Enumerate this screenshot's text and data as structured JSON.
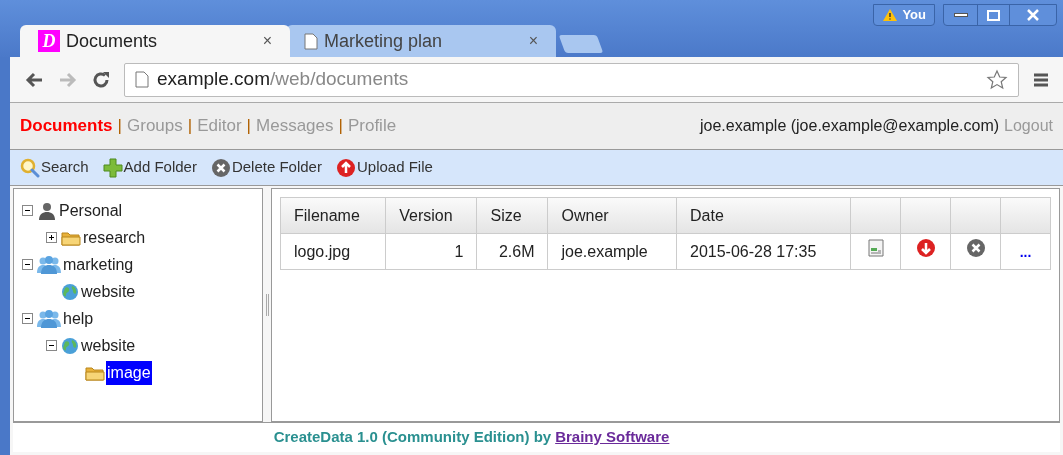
{
  "browser": {
    "tabs": [
      {
        "title": "Documents",
        "kind": "app",
        "favicon": "D",
        "selected": true,
        "close": "×"
      },
      {
        "title": "Marketing plan",
        "kind": "page",
        "selected": false,
        "close": "×"
      }
    ],
    "profile": "You",
    "url_host": "example.com",
    "url_path": "/web/documents"
  },
  "nav": {
    "separator": "|",
    "items": [
      {
        "label": "Documents",
        "selected": true
      },
      {
        "label": "Groups",
        "selected": false
      },
      {
        "label": "Editor",
        "selected": false
      },
      {
        "label": "Messages",
        "selected": false
      },
      {
        "label": "Profile",
        "selected": false
      }
    ],
    "user": "joe.example (joe.example@example.com)",
    "logout": "Logout"
  },
  "toolbar": [
    {
      "label": "Search",
      "kind": "search"
    },
    {
      "label": "Add Folder",
      "kind": "add"
    },
    {
      "label": "Delete Folder",
      "kind": "delete"
    },
    {
      "label": "Upload File",
      "kind": "upload"
    }
  ],
  "tree": [
    {
      "label": "Personal",
      "kind": "person",
      "expanded": true,
      "selected": false,
      "children": [
        {
          "label": "research",
          "kind": "folder",
          "expanded": false,
          "selected": false
        }
      ]
    },
    {
      "label": "marketing",
      "kind": "group",
      "expanded": true,
      "selected": false,
      "children": [
        {
          "label": "website",
          "kind": "globe",
          "selected": false
        }
      ]
    },
    {
      "label": "help",
      "kind": "group",
      "expanded": true,
      "selected": false,
      "children": [
        {
          "label": "website",
          "kind": "globe",
          "expanded": true,
          "selected": false,
          "children": [
            {
              "label": "image",
              "kind": "folder",
              "selected": true
            }
          ]
        }
      ]
    }
  ],
  "table": {
    "columns": [
      "Filename",
      "Version",
      "Size",
      "Owner",
      "Date"
    ],
    "rows": [
      {
        "cells": [
          "logo.jpg",
          "1",
          "2.6M",
          "joe.example",
          "2015-06-28 17:35"
        ],
        "actions": [
          {
            "kind": "preview"
          },
          {
            "kind": "download"
          },
          {
            "kind": "delete"
          },
          {
            "kind": "more",
            "label": "..."
          }
        ]
      }
    ]
  },
  "footer": {
    "text": "CreateData 1.0 (Community Edition) by",
    "link": "Brainy Software"
  }
}
